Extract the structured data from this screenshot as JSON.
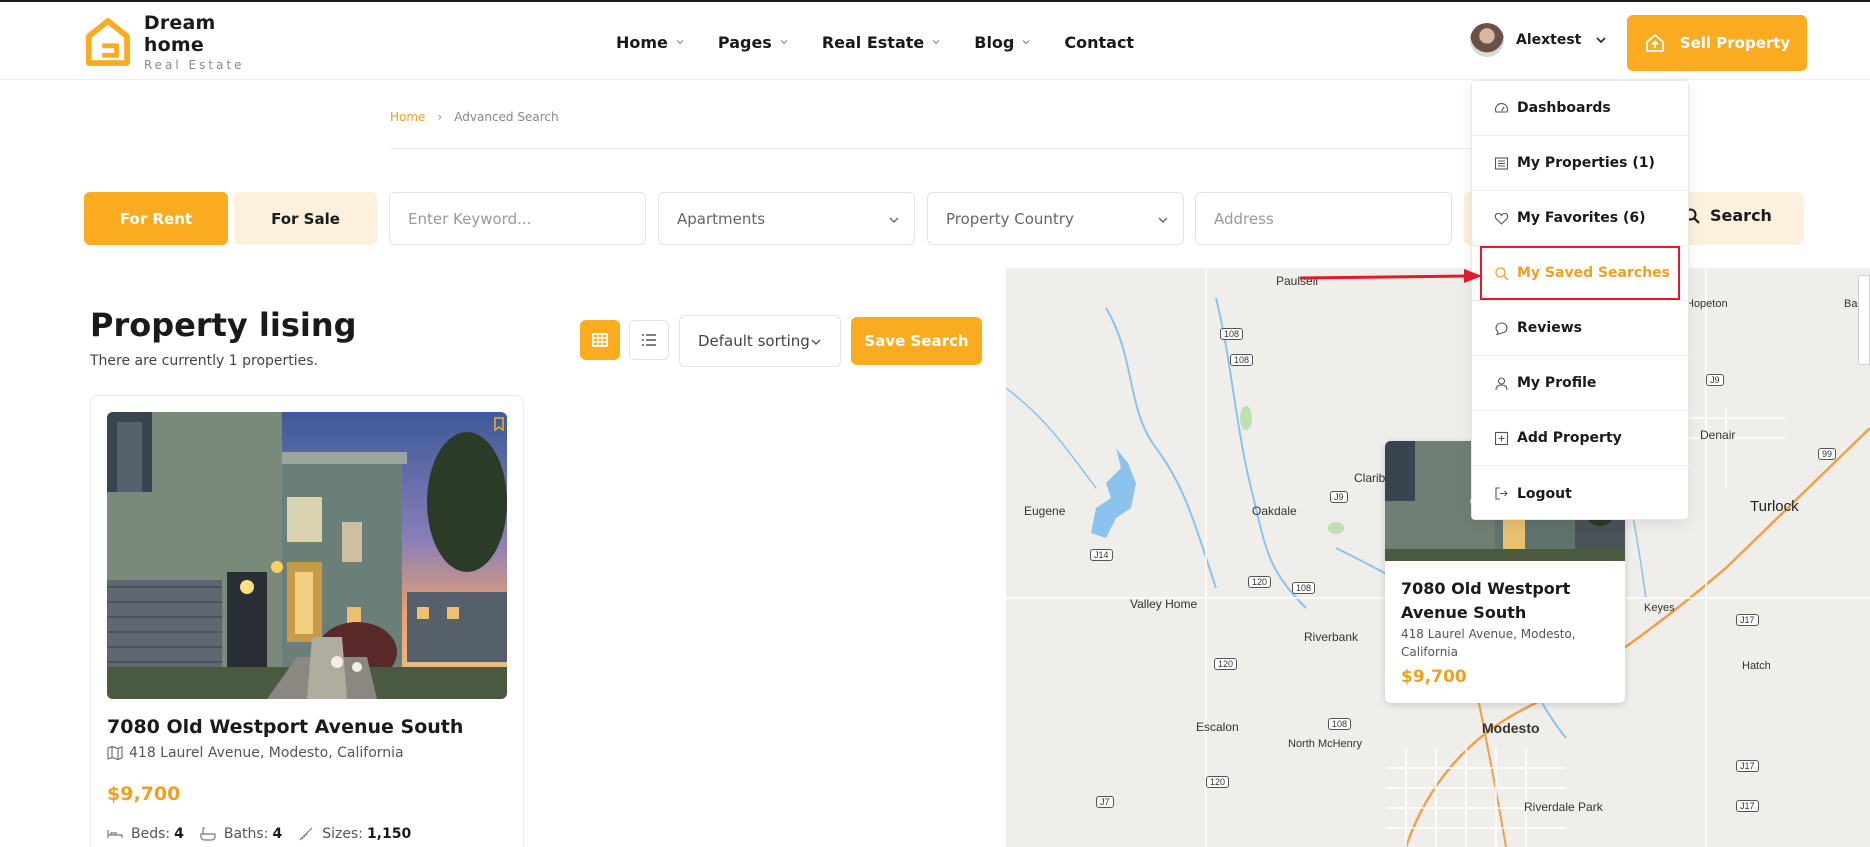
{
  "header": {
    "logo_title": "Dream home",
    "logo_subtitle": "Real Estate",
    "nav": [
      "Home",
      "Pages",
      "Real Estate",
      "Blog",
      "Contact"
    ],
    "user_name": "Alextest",
    "sell_label": "Sell Property"
  },
  "breadcrumb": {
    "home": "Home",
    "separator": "›",
    "current": "Advanced Search"
  },
  "search": {
    "tab_rent": "For Rent",
    "tab_sale": "For Sale",
    "keyword_placeholder": "Enter Keyword...",
    "type_value": "Apartments",
    "country_value": "Property Country",
    "address_placeholder": "Address",
    "search_label": "Search"
  },
  "listing": {
    "title": "Property lising",
    "subtitle": "There are currently 1 properties.",
    "sort_value": "Default sorting",
    "save_search_label": "Save Search"
  },
  "card": {
    "title": "7080 Old Westport Avenue South",
    "address": "418 Laurel Avenue, Modesto, California",
    "price": "$9,700",
    "beds_label": "Beds:",
    "beds": "4",
    "baths_label": "Baths:",
    "baths": "4",
    "sizes_label": "Sizes:",
    "sizes": "1,150"
  },
  "popup": {
    "title": "7080 Old Westport Avenue South",
    "address": "418 Laurel Avenue, Modesto, California",
    "price": "$9,700"
  },
  "map_labels": [
    "Paulsell",
    "Eugene",
    "Oakdale",
    "Claribel",
    "Valley Home",
    "Riverbank",
    "Escalon",
    "North McHenry",
    "Modesto",
    "Riverdale Park",
    "Denair",
    "Turlock",
    "Keyes",
    "Hatch",
    "Ballico",
    "Hopeton"
  ],
  "map_shields": [
    "108",
    "108",
    "J9",
    "J14",
    "120",
    "108",
    "120",
    "108",
    "120",
    "J7",
    "J9",
    "99",
    "J17",
    "J17",
    "J17"
  ],
  "user_menu": [
    {
      "label": "Dashboards",
      "icon": "dashboard-icon"
    },
    {
      "label": "My Properties (1)",
      "icon": "list-icon"
    },
    {
      "label": "My Favorites (6)",
      "icon": "heart-icon"
    },
    {
      "label": "My Saved Searches",
      "icon": "search-icon",
      "active": true
    },
    {
      "label": "Reviews",
      "icon": "chat-icon"
    },
    {
      "label": "My Profile",
      "icon": "user-icon"
    },
    {
      "label": "Add Property",
      "icon": "plus-square-icon"
    },
    {
      "label": "Logout",
      "icon": "logout-icon"
    }
  ],
  "colors": {
    "accent": "#fbab20",
    "accent_light": "#fdf0dc",
    "annotation_red": "#e2192a"
  }
}
